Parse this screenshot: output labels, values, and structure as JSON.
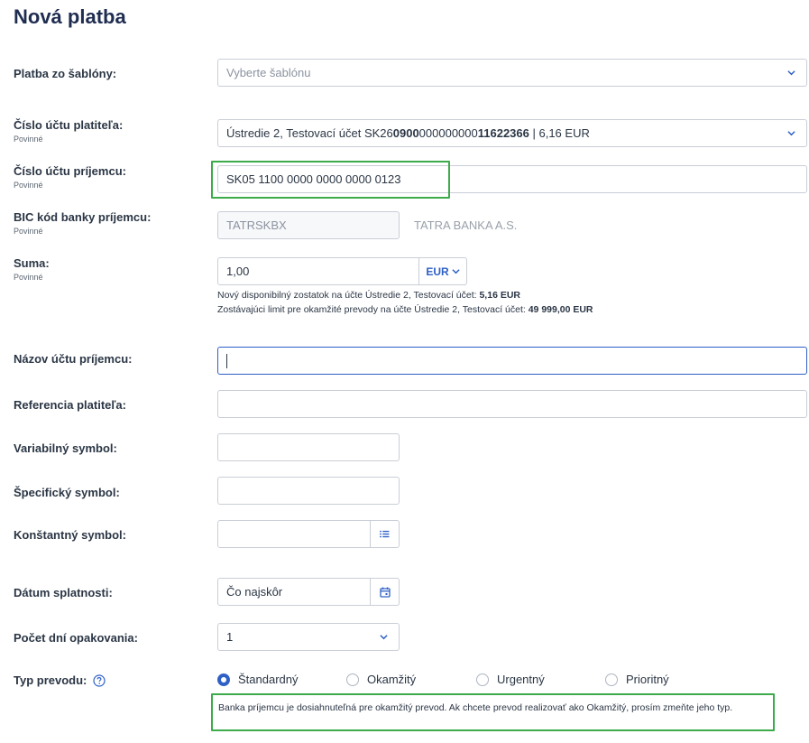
{
  "page": {
    "title": "Nová platba"
  },
  "template": {
    "label": "Platba zo šablóny:",
    "placeholder": "Vyberte šablónu"
  },
  "payer_account": {
    "label": "Číslo účtu platiteľa:",
    "required": "Povinné",
    "prefix": "Ústredie 2, Testovací účet SK26",
    "bold1": "0900",
    "mid": "000000000",
    "bold2": "11622366",
    "sep": " | ",
    "balance": "6,16 EUR"
  },
  "payee_account": {
    "label": "Číslo účtu príjemcu:",
    "required": "Povinné",
    "value": "SK05 1100 0000 0000 0000 0123"
  },
  "bic": {
    "label": "BIC kód banky príjemcu:",
    "required": "Povinné",
    "value": "TATRSKBX",
    "bank_name": "TATRA BANKA A.S."
  },
  "amount": {
    "label": "Suma:",
    "required": "Povinné",
    "value": "1,00",
    "currency": "EUR",
    "note1_text": "Nový disponibilný zostatok na účte Ústredie 2, Testovací účet: ",
    "note1_value": "5,16 EUR",
    "note2_text": "Zostávajúci limit pre okamžité prevody na účte Ústredie 2, Testovací účet: ",
    "note2_value": "49 999,00 EUR"
  },
  "payee_name": {
    "label": "Názov účtu príjemcu:",
    "value": ""
  },
  "payer_reference": {
    "label": "Referencia platiteľa:",
    "value": ""
  },
  "variable_symbol": {
    "label": "Variabilný symbol:",
    "value": ""
  },
  "specific_symbol": {
    "label": "Špecifický symbol:",
    "value": ""
  },
  "constant_symbol": {
    "label": "Konštantný symbol:",
    "value": ""
  },
  "due_date": {
    "label": "Dátum splatnosti:",
    "value": "Čo najskôr"
  },
  "repeat_days": {
    "label": "Počet dní opakovania:",
    "value": "1"
  },
  "transfer_type": {
    "label": "Typ prevodu:",
    "selected": 0,
    "options": [
      "Štandardný",
      "Okamžitý",
      "Urgentný",
      "Prioritný"
    ],
    "message": "Banka príjemcu je dosiahnuteľná pre okamžitý prevod. Ak chcete prevod realizovať ako Okamžitý, prosím zmeňte jeho typ."
  },
  "colors": {
    "accent": "#2f60c6",
    "highlight": "#3dab4a",
    "title": "#1f2d50"
  }
}
